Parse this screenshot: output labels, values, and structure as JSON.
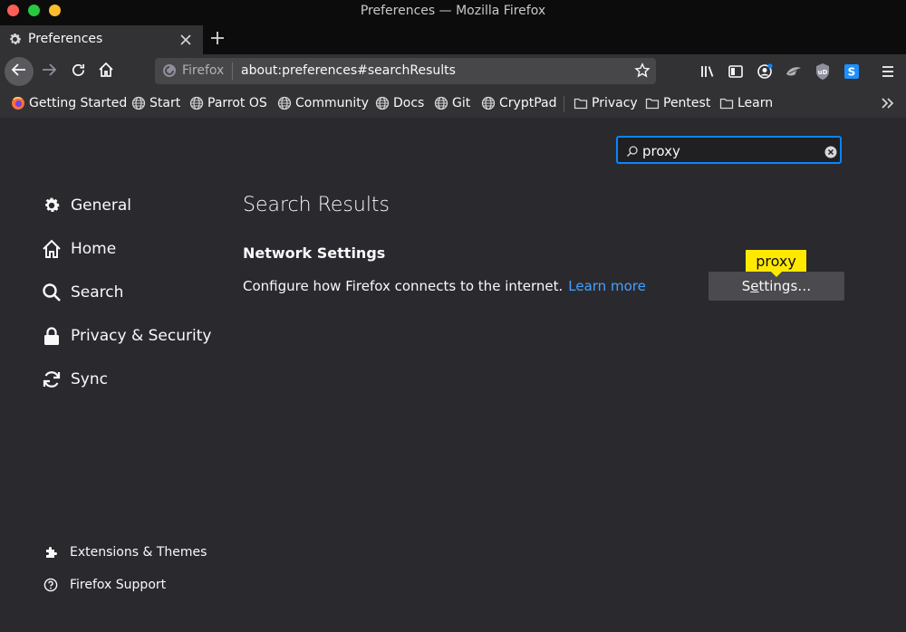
{
  "window": {
    "title": "Preferences — Mozilla Firefox"
  },
  "tab": {
    "label": "Preferences"
  },
  "urlbar": {
    "identity": "Firefox",
    "url": "about:preferences#searchResults"
  },
  "bookmarks": [
    {
      "label": "Getting Started",
      "icon": "firefox-icon"
    },
    {
      "label": "Start",
      "icon": "globe-icon"
    },
    {
      "label": "Parrot OS",
      "icon": "globe-icon"
    },
    {
      "label": "Community",
      "icon": "globe-icon"
    },
    {
      "label": "Docs",
      "icon": "globe-icon"
    },
    {
      "label": "Git",
      "icon": "globe-icon"
    },
    {
      "label": "CryptPad",
      "icon": "globe-icon"
    },
    {
      "label": "Privacy",
      "icon": "folder-icon"
    },
    {
      "label": "Pentest",
      "icon": "folder-icon"
    },
    {
      "label": "Learn",
      "icon": "folder-icon"
    }
  ],
  "search": {
    "value": "proxy"
  },
  "categories": [
    {
      "label": "General",
      "icon": "gear-icon"
    },
    {
      "label": "Home",
      "icon": "home-icon"
    },
    {
      "label": "Search",
      "icon": "search-icon"
    },
    {
      "label": "Privacy & Security",
      "icon": "lock-icon"
    },
    {
      "label": "Sync",
      "icon": "sync-icon"
    }
  ],
  "footer": [
    {
      "label": "Extensions & Themes",
      "icon": "puzzle-icon"
    },
    {
      "label": "Firefox Support",
      "icon": "help-icon"
    }
  ],
  "results": {
    "title": "Search Results",
    "group_title": "Network Settings",
    "description": "Configure how Firefox connects to the internet.",
    "learn_more": "Learn more",
    "settings_button_pre": "S",
    "settings_button_accesskey": "e",
    "settings_button_post": "ttings…",
    "highlight": "proxy"
  },
  "colors": {
    "background": "#2a2a2e",
    "toolbar": "#323234",
    "accent": "#0a84ff",
    "link": "#45a1ff",
    "highlight": "#ffe900"
  }
}
